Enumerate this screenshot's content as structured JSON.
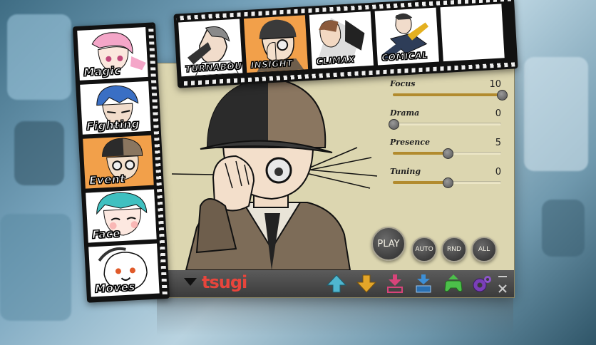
{
  "film_vertical": {
    "frames": [
      {
        "label": "Magic",
        "active": false
      },
      {
        "label": "Fighting",
        "active": false
      },
      {
        "label": "Event",
        "active": true
      },
      {
        "label": "Face",
        "active": false
      },
      {
        "label": "Moves",
        "active": false
      }
    ]
  },
  "film_horizontal": {
    "frames": [
      {
        "label": "TURNABOUT",
        "active": false
      },
      {
        "label": "INSIGHT",
        "active": true
      },
      {
        "label": "CLIMAX",
        "active": false
      },
      {
        "label": "COMICAL",
        "active": false
      },
      {
        "label": "",
        "active": false
      }
    ]
  },
  "sliders": [
    {
      "name": "Focus",
      "value": "10",
      "fraction": 1.0
    },
    {
      "name": "Drama",
      "value": "0",
      "fraction": 0.0
    },
    {
      "name": "Presence",
      "value": "5",
      "fraction": 0.5
    },
    {
      "name": "Tuning",
      "value": "0",
      "fraction": 0.5
    }
  ],
  "buttons": {
    "play": "PLAY",
    "auto": "AUTO",
    "rnd": "RND",
    "all": "ALL"
  },
  "toolbar": {
    "logo": "tsugi",
    "icons": [
      "up-arrow-icon",
      "down-arrow-icon",
      "import-icon",
      "export-icon",
      "gamepad-icon",
      "gears-icon"
    ],
    "colors": {
      "up": "#4fb6cf",
      "down": "#e4a629",
      "import": "#d8447a",
      "export": "#3d8fd6",
      "gamepad": "#4cbf4a",
      "gears": "#7a3fb8"
    }
  },
  "colors": {
    "accent_orange": "#f2a04a",
    "slider_fill": "#b28b2e",
    "panel_bg": "#dcd6b0"
  }
}
